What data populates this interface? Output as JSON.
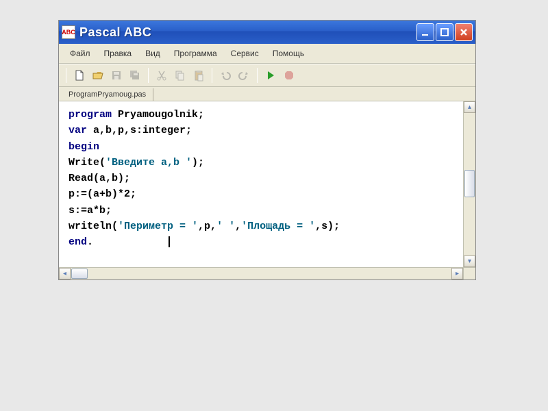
{
  "window": {
    "app_icon_text": "ABC",
    "title": "Pascal ABC"
  },
  "menu": {
    "items": [
      "Файл",
      "Правка",
      "Вид",
      "Программа",
      "Сервис",
      "Помощь"
    ]
  },
  "tabs": {
    "items": [
      "ProgramPryamoug.pas"
    ]
  },
  "code": {
    "l1_kw": "program",
    "l1_rest": " Pryamougolnik;",
    "l2_kw": "var",
    "l2_rest": " a,b,p,s:integer;",
    "l3_kw": "begin",
    "l4_a": "Write(",
    "l4_str": "'Введите a,b '",
    "l4_b": ");",
    "l5": "Read(a,b);",
    "l6": "p:=(a+b)*2;",
    "l7": "s:=a*b;",
    "l8_a": "writeln(",
    "l8_s1": "'Периметр = '",
    "l8_b": ",p,",
    "l8_s2": "' '",
    "l8_c": ",",
    "l8_s3": "'Площадь = '",
    "l8_d": ",s);",
    "l9_kw": "end",
    "l9_rest": "."
  }
}
